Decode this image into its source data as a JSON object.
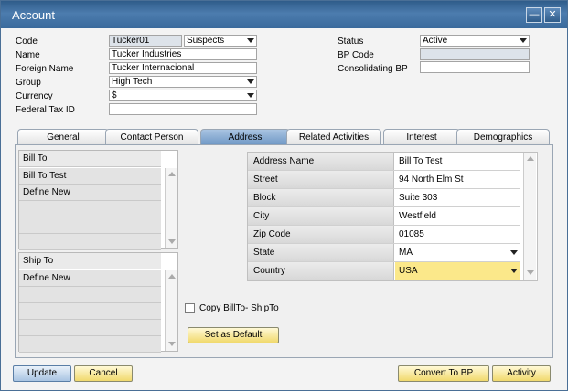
{
  "window": {
    "title": "Account",
    "minimize": "—",
    "close": "✕"
  },
  "header": {
    "code": {
      "label": "Code",
      "value": "Tucker01",
      "type": "Suspects"
    },
    "name": {
      "label": "Name",
      "value": "Tucker Industries"
    },
    "foreign_name": {
      "label": "Foreign Name",
      "value": "Tucker Internacional"
    },
    "group": {
      "label": "Group",
      "value": "High Tech"
    },
    "currency": {
      "label": "Currency",
      "value": "$"
    },
    "federal_tax": {
      "label": "Federal Tax ID",
      "value": ""
    },
    "status": {
      "label": "Status",
      "value": "Active"
    },
    "bp_code": {
      "label": "BP Code",
      "value": ""
    },
    "consolidating": {
      "label": "Consolidating BP",
      "value": ""
    }
  },
  "tabs": [
    {
      "label": "General"
    },
    {
      "label": "Contact Person"
    },
    {
      "label": "Address"
    },
    {
      "label": "Related Activities"
    },
    {
      "label": "Interest"
    },
    {
      "label": "Demographics"
    }
  ],
  "bill_to": {
    "header": "Bill To",
    "items": [
      "Bill To Test",
      "Define New"
    ]
  },
  "ship_to": {
    "header": "Ship To",
    "items": [
      "Define New"
    ]
  },
  "address": [
    {
      "name": "Address Name",
      "value": "Bill To Test"
    },
    {
      "name": "Street",
      "value": "94 North Elm St"
    },
    {
      "name": "Block",
      "value": "Suite 303"
    },
    {
      "name": "City",
      "value": "Westfield"
    },
    {
      "name": "Zip Code",
      "value": "01085"
    },
    {
      "name": "State",
      "value": "MA"
    },
    {
      "name": "Country",
      "value": "USA"
    }
  ],
  "copy_checkbox": {
    "label": "Copy BillTo- ShipTo"
  },
  "buttons": {
    "set_default": "Set as Default",
    "update": "Update",
    "cancel": "Cancel",
    "convert": "Convert To BP",
    "activity": "Activity"
  }
}
